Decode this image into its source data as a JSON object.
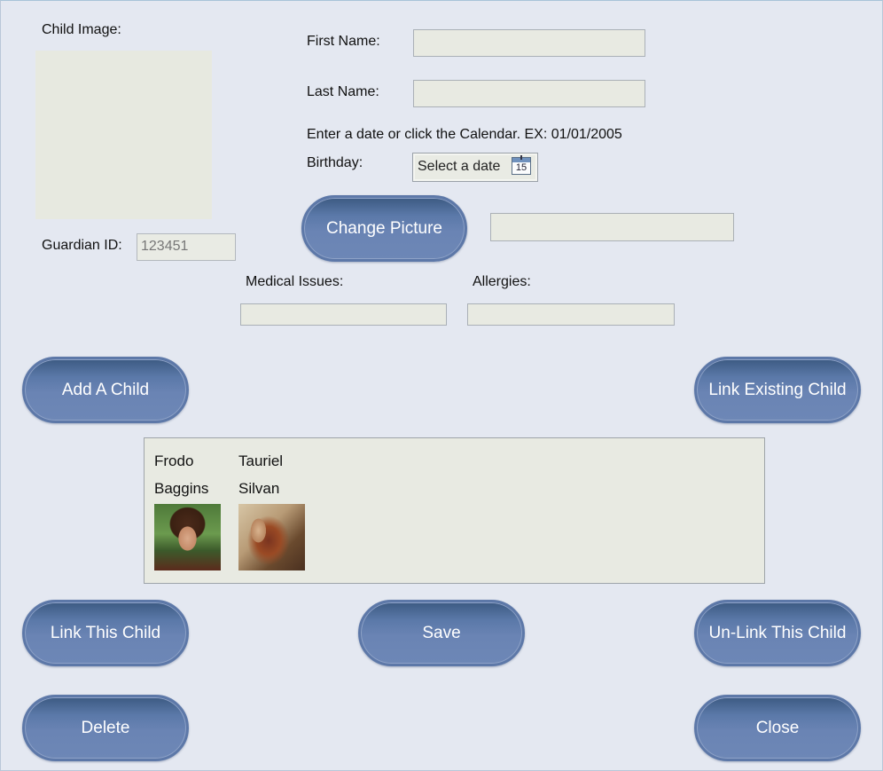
{
  "form": {
    "child_image_label": "Child Image:",
    "first_name_label": "First Name:",
    "first_name_value": "",
    "last_name_label": "Last Name:",
    "last_name_value": "",
    "date_hint": "Enter a date or click the Calendar. EX: 01/01/2005",
    "birthday_label": "Birthday:",
    "birthday_placeholder": "Select a date",
    "calendar_day": "15",
    "guardian_id_label": "Guardian ID:",
    "guardian_id_value": "123451",
    "picture_path_value": "",
    "medical_issues_label": "Medical Issues:",
    "medical_issues_value": "",
    "allergies_label": "Allergies:",
    "allergies_value": ""
  },
  "buttons": {
    "change_picture": "Change Picture",
    "add_child": "Add A Child",
    "link_existing_child": "Link Existing Child",
    "link_this_child": "Link This Child",
    "save": "Save",
    "unlink_this_child": "Un-Link This Child",
    "delete": "Delete",
    "close": "Close"
  },
  "children": [
    {
      "first": "Frodo",
      "last": "Baggins"
    },
    {
      "first": "Tauriel",
      "last": "Silvan"
    }
  ],
  "colors": {
    "background": "#e4e8f1",
    "button": "#6a84b4",
    "field": "#e8eae2"
  }
}
